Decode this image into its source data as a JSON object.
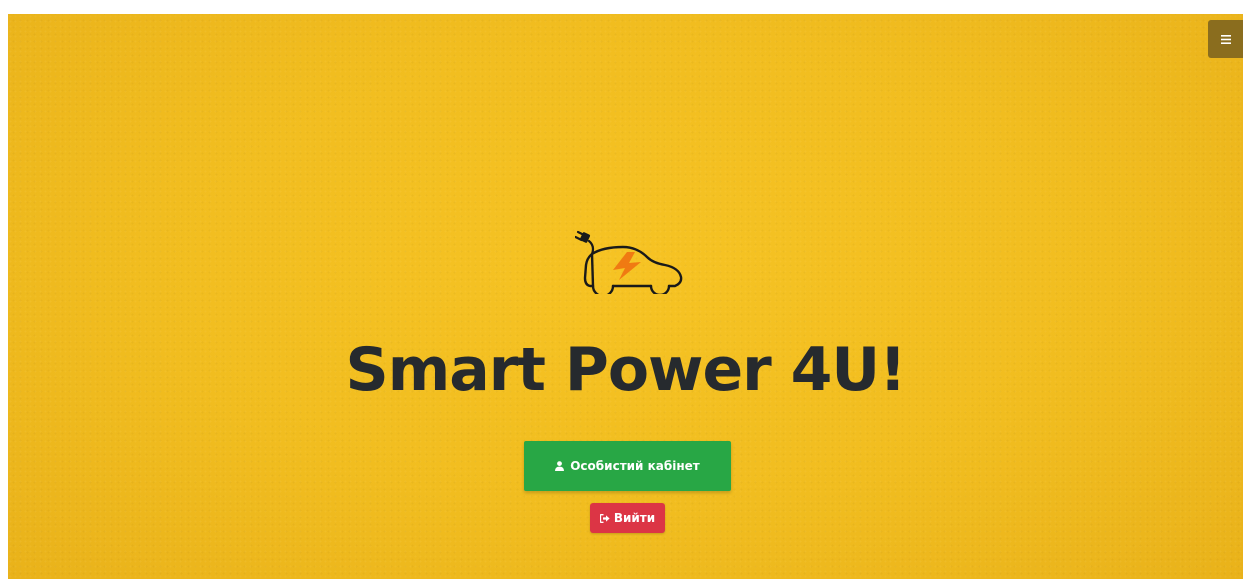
{
  "header": {
    "menu_icon": "menu-icon"
  },
  "hero": {
    "logo_icon": "electric-car-icon",
    "title": "Smart Power 4U!",
    "cabinet_button": {
      "label": "Особистий кабінет",
      "icon": "user-icon"
    },
    "logout_button": {
      "label": "Вийти",
      "icon": "sign-out-icon"
    }
  },
  "colors": {
    "background": "#f1bd1f",
    "title": "#262a2e",
    "success": "#28a745",
    "danger": "#dc3545",
    "menu": "#8a6d1e",
    "logo_accent": "#f07a12"
  }
}
